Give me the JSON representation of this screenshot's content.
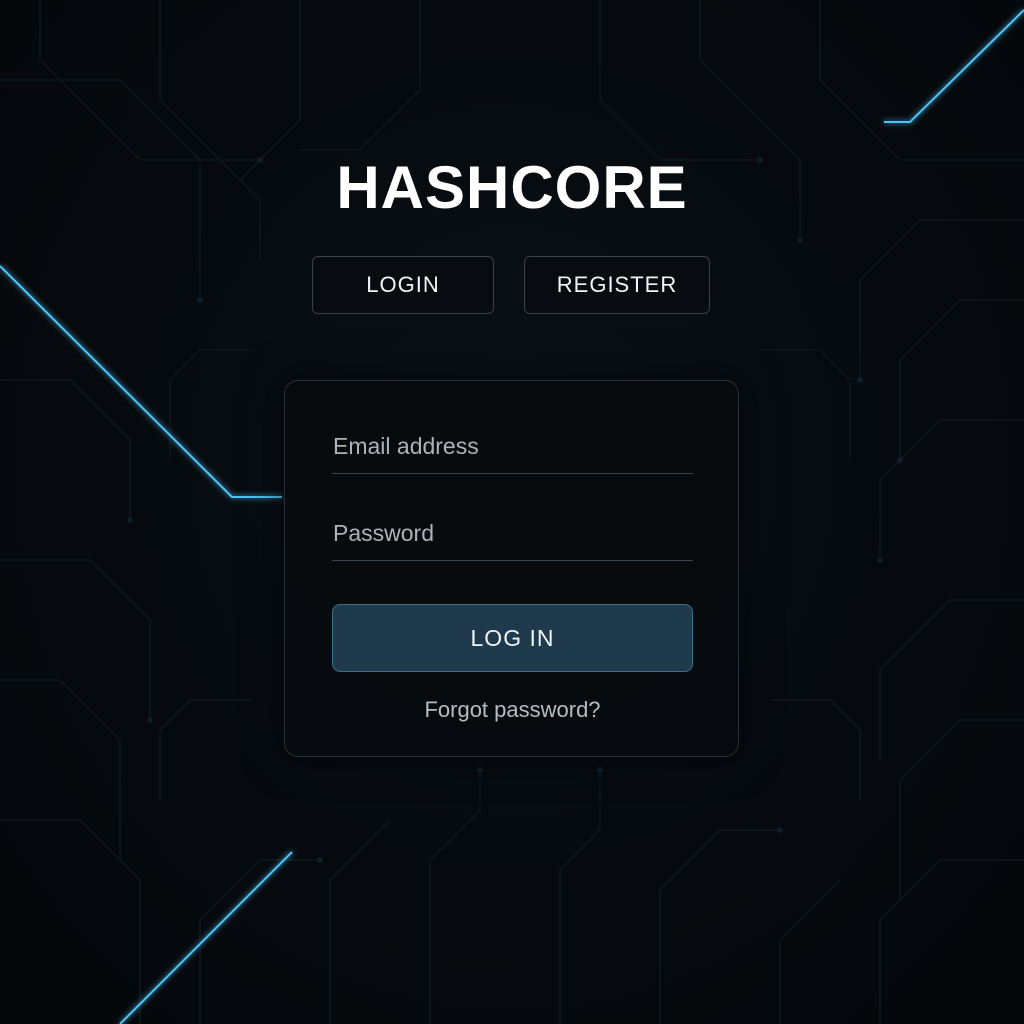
{
  "brand": {
    "title": "HASHCORE"
  },
  "tabs": {
    "login_label": "LOGIN",
    "register_label": "REGISTER"
  },
  "form": {
    "email_placeholder": "Email address",
    "email_value": "",
    "password_placeholder": "Password",
    "password_value": "",
    "submit_label": "LOG IN",
    "forgot_label": "Forgot password?"
  },
  "colors": {
    "background": "#05080b",
    "accent_glow": "#4fc3f7",
    "submit_fill": "#1e3a4c",
    "text_primary": "#ffffff"
  }
}
